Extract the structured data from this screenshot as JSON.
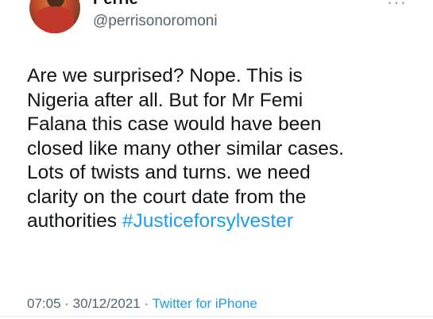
{
  "author": {
    "display_name": "Perrie",
    "handle": "@perrisonoromoni",
    "avatar_icon": "profile-photo-avatar"
  },
  "more_icon": "more-dots-icon",
  "tweet": {
    "lines": [
      "Are we surprised? Nope. This is",
      "Nigeria after all. But for Mr Femi",
      "Falana this case would have been",
      "closed like many other similar cases.",
      "Lots of twists and turns. we need",
      "clarity on the court date from the"
    ],
    "last_line_text": "authorities ",
    "hashtag": "#Justiceforsylvester"
  },
  "meta": {
    "time": "07:05",
    "separator1": " · ",
    "date": "30/12/2021",
    "separator2": " · ",
    "source": "Twitter for iPhone"
  },
  "colors": {
    "link": "#1d9bf0",
    "secondary_text": "#536471",
    "primary_text": "#0f1419"
  }
}
